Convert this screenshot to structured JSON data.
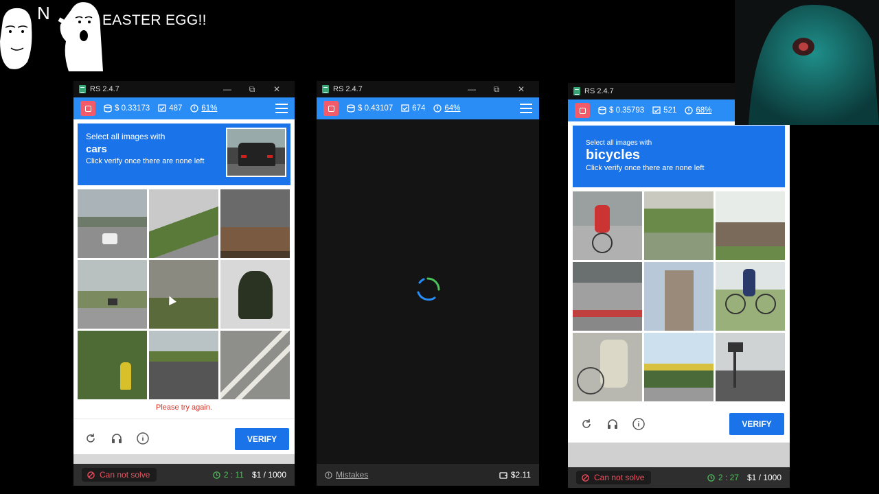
{
  "overlay": {
    "meme_caption": "EASTER EGG!!",
    "meme_letter": "N"
  },
  "windows": [
    {
      "title": "RS 2.4.7",
      "balance": "$ 0.33173",
      "solved": "487",
      "accuracy": "61%",
      "prompt": {
        "line1": "Select all images with",
        "keyword": "cars",
        "line3": "Click verify once there are none left"
      },
      "error": "Please try again.",
      "verify_label": "VERIFY",
      "status_label": "Can not solve",
      "timer": "2 : 11",
      "rate": "$1 / 1000"
    },
    {
      "title": "RS 2.4.7",
      "balance": "$ 0.43107",
      "solved": "674",
      "accuracy": "64%",
      "mistakes_label": "Mistakes",
      "wallet": "$2.11"
    },
    {
      "title": "RS 2.4.7",
      "balance": "$ 0.35793",
      "solved": "521",
      "accuracy": "68%",
      "prompt": {
        "line1": "Select all images with",
        "keyword": "bicycles",
        "line3": "Click verify once there are none left"
      },
      "verify_label": "VERIFY",
      "status_label": "Can not solve",
      "timer": "2 : 27",
      "rate": "$1 / 1000"
    }
  ],
  "colors": {
    "accent": "#2a8cf5",
    "captcha_blue": "#1a73e8",
    "stop": "#f25c6a",
    "error": "#f05060",
    "timer": "#4cc35a"
  }
}
